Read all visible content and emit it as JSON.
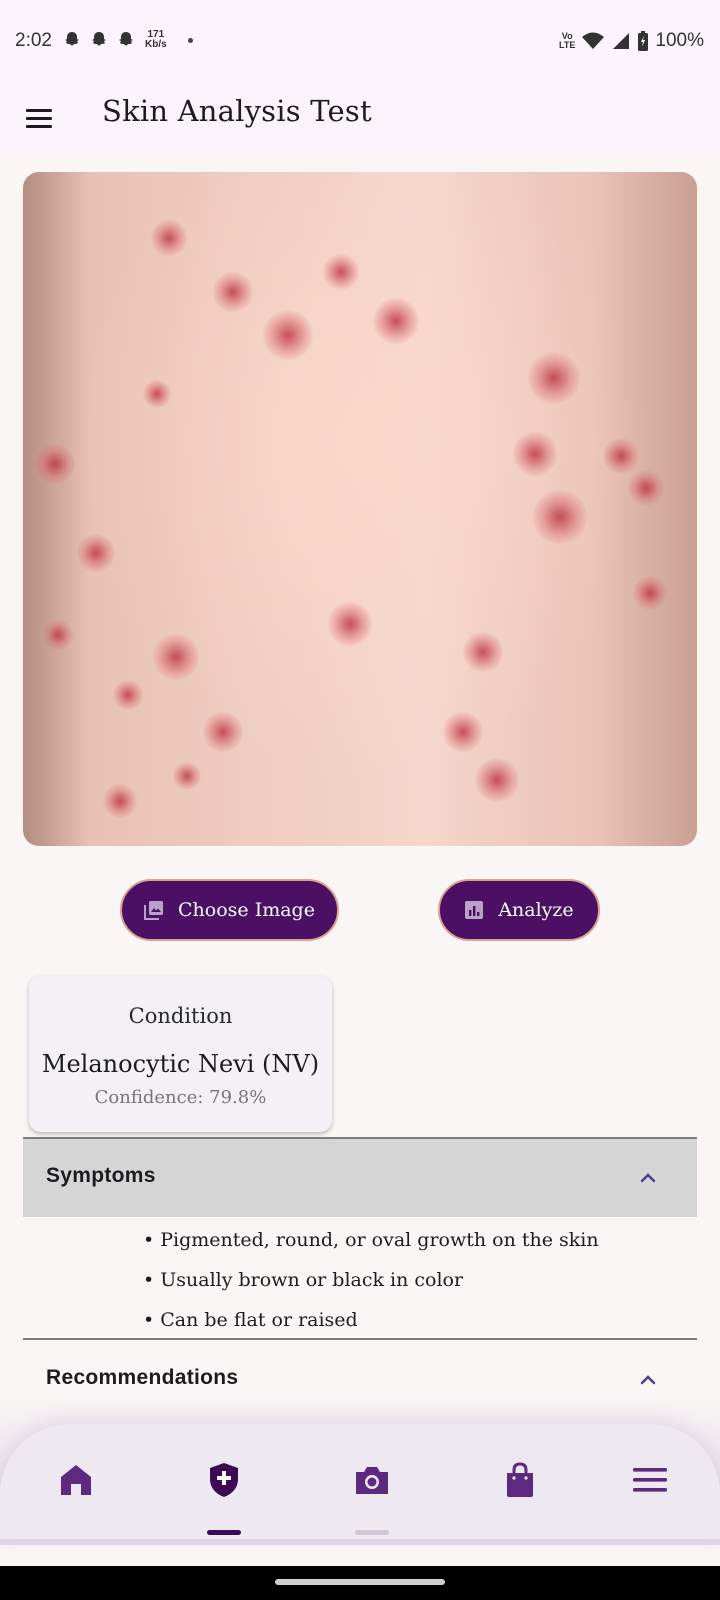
{
  "status_bar": {
    "time": "2:02",
    "net_speed_value": "171",
    "net_speed_unit": "Kb/s",
    "volte_top": "Vo",
    "volte_bottom": "LTE",
    "battery": "100%"
  },
  "app_bar": {
    "title": "Skin Analysis Test"
  },
  "actions": {
    "choose_image_label": "Choose Image",
    "analyze_label": "Analyze"
  },
  "result": {
    "condition_label": "Condition",
    "condition_value": "Melanocytic Nevi (NV)",
    "confidence": "Confidence: 79.8%"
  },
  "sections": {
    "symptoms": {
      "title": "Symptoms",
      "expanded": true,
      "items": [
        "• Pigmented, round, or oval growth on the skin",
        "• Usually brown or black in color",
        "• Can be flat or raised"
      ]
    },
    "recommendations": {
      "title": "Recommendations",
      "expanded": true
    }
  },
  "bottom_nav": {
    "items": [
      {
        "icon": "home-icon",
        "selected": false
      },
      {
        "icon": "shield-plus-icon",
        "selected": true
      },
      {
        "icon": "camera-icon",
        "selected": false
      },
      {
        "icon": "shopping-bag-icon",
        "selected": false
      },
      {
        "icon": "menu-icon",
        "selected": false
      }
    ]
  },
  "colors": {
    "primary": "#4b0f63",
    "button_border": "#d8a38e",
    "nav_icon": "#5e2a80",
    "nav_icon_selected": "#3d0a55",
    "app_bar_bg": "#fcf4fc",
    "page_bg": "#f9f6f5",
    "symptoms_header_bg": "#d6d5d6"
  }
}
